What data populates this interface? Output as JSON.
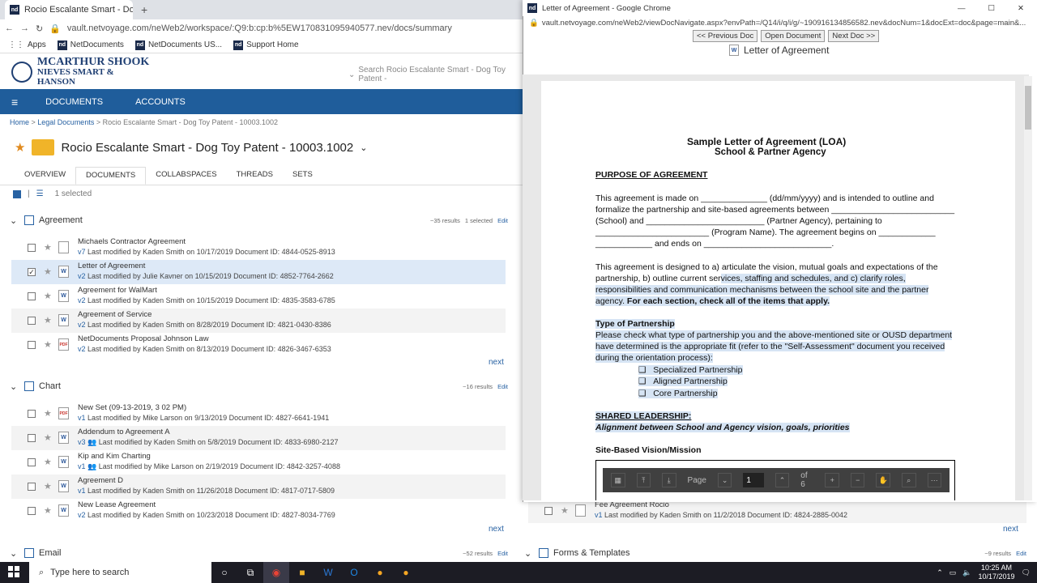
{
  "browser": {
    "tab_title": "Rocio Escalante Smart - Dog To",
    "new_tab": "+",
    "url": "vault.netvoyage.com/neWeb2/workspace/:Q9:b:cp:b%5EW170831095940577.nev/docs/summary",
    "bookmarks": [
      "Apps",
      "NetDocuments",
      "NetDocuments US...",
      "Support Home"
    ]
  },
  "app": {
    "logo_line1": "MCARTHUR SHOOK",
    "logo_line2": "NIEVES SMART & HANSON",
    "search_placeholder": "Search Rocio Escalante Smart - Dog Toy Patent -",
    "nav": [
      "DOCUMENTS",
      "ACCOUNTS"
    ],
    "breadcrumb": {
      "home": "Home",
      "sep1": " > ",
      "legal": "Legal Documents",
      "sep2": " > ",
      "current": "Rocio Escalante Smart - Dog Toy Patent - 10003.1002"
    },
    "workspace_title": "Rocio Escalante Smart - Dog Toy Patent - 10003.1002",
    "tabs": [
      "OVERVIEW",
      "DOCUMENTS",
      "COLLABSPACES",
      "THREADS",
      "SETS"
    ],
    "selected_text": "1 selected"
  },
  "groups": {
    "agreement": {
      "title": "Agreement",
      "results": "~35 results",
      "selected": "1 selected",
      "edit": "Edit",
      "docs": [
        {
          "name": "Michaels Contractor Agreement",
          "ver": "v7",
          "info": "Last modified by Kaden Smith on 10/17/2019   Document ID: 4844-0525-8913",
          "icon": ""
        },
        {
          "name": "Letter of Agreement",
          "ver": "v2",
          "info": "Last modified by Julie Kavner on 10/15/2019   Document ID: 4852-7764-2662",
          "icon": "W"
        },
        {
          "name": "Agreement for WalMart",
          "ver": "v2",
          "info": "Last modified by Kaden Smith on 10/15/2019   Document ID: 4835-3583-6785",
          "icon": "W"
        },
        {
          "name": "Agreement of Service",
          "ver": "v2",
          "info": "Last modified by Kaden Smith on 8/28/2019   Document ID: 4821-0430-8386",
          "icon": "W"
        },
        {
          "name": "NetDocuments Proposal Johnson Law",
          "ver": "v2",
          "info": "Last modified by Kaden Smith on 8/13/2019   Document ID: 4826-3467-6353",
          "icon": "PDF"
        }
      ],
      "next": "next"
    },
    "chart": {
      "title": "Chart",
      "results": "~16 results",
      "edit": "Edit",
      "docs": [
        {
          "name": "New Set (09-13-2019, 3 02 PM)",
          "ver": "v1",
          "info": "Last modified by Mike Larson on 9/13/2019   Document ID: 4827-6641-1941",
          "icon": "PDF"
        },
        {
          "name": "Addendum to Agreement A",
          "ver": "v3",
          "info": "Last modified by Kaden Smith on 5/8/2019   Document ID: 4833-6980-2127",
          "icon": "W"
        },
        {
          "name": "Kip and Kim Charting",
          "ver": "v1",
          "info": "Last modified by Mike Larson on 2/19/2019   Document ID: 4842-3257-4088",
          "icon": "W"
        },
        {
          "name": "Agreement D",
          "ver": "v1",
          "info": "Last modified by Kaden Smith on 11/26/2018   Document ID: 4817-0717-5809",
          "icon": "W"
        },
        {
          "name": "New Lease Agreement",
          "ver": "v2",
          "info": "Last modified by Kaden Smith on 10/23/2018   Document ID: 4827-8034-7769",
          "icon": "W"
        }
      ],
      "next": "next"
    },
    "email": {
      "title": "Email",
      "results": "~52 results",
      "edit": "Edit"
    },
    "right": {
      "fee_name": "Fee Agreement Rocio",
      "fee_ver": "v1",
      "fee_info": "Last modified by Kaden Smith on 11/2/2018   Document ID: 4824-2885-0042",
      "next": "next",
      "forms_title": "Forms & Templates",
      "forms_results": "~9 results",
      "forms_edit": "Edit"
    }
  },
  "popup": {
    "title": "Letter of Agreement - Google Chrome",
    "url": "vault.netvoyage.com/neWeb2/viewDocNavigate.aspx?envPath=/Q14/i/q/i/g/~190916134856582.nev&docNum=1&docExt=doc&page=main&...",
    "buttons": [
      "<< Previous Doc",
      "Open Document",
      "Next Doc >>"
    ],
    "doc_title": "Letter of Agreement",
    "toolbar": {
      "page_label": "Page",
      "page_value": "1",
      "of_label": "of 6"
    }
  },
  "document": {
    "title1": "Sample Letter of Agreement (LOA)",
    "title2": "School & Partner Agency",
    "h_purpose": "PURPOSE OF AGREEMENT",
    "p1": [
      "This agreement is made on ______________ (dd/mm/yyyy) and is intended to outline and",
      "formalize the partnership and site-based agreements between __________________________",
      "(School) and _________________________ (Partner Agency), pertaining to",
      "________________________ (Program Name).  The agreement begins on ____________",
      "____________ and ends on ___________________________."
    ],
    "p2a": "This agreement is designed to a) articulate the vision, mutual goals and expectations of the",
    "p2b_plain": "partnership, b) outline current ser",
    "p2b_hl": "vices, staffing and schedules, and c) clarify roles,",
    "p2c": "responsibilities and communication mechanisms between the school site and the partner",
    "p2d_plain": "agency.  ",
    "p2d_bold": "For each section, check all of the items that apply.",
    "h_type": "Type of Partnership",
    "p3": [
      "Please check what type of partnership you and the above-mentioned site or OUSD department",
      "have determined is the appropriate fit (refer to the \"Self-Assessment\" document you received",
      "during the orientation process):"
    ],
    "checks": [
      "Specialized Partnership",
      "Aligned Partnership",
      "Core Partnership"
    ],
    "h_shared": "SHARED LEADERSHIP:",
    "shared_sub": "Alignment between School and Agency vision, goals, priorities",
    "h_vision": "Site-Based Vision/Mission"
  },
  "taskbar": {
    "search": "Type here to search",
    "time": "10:25 AM",
    "date": "10/17/2019"
  }
}
